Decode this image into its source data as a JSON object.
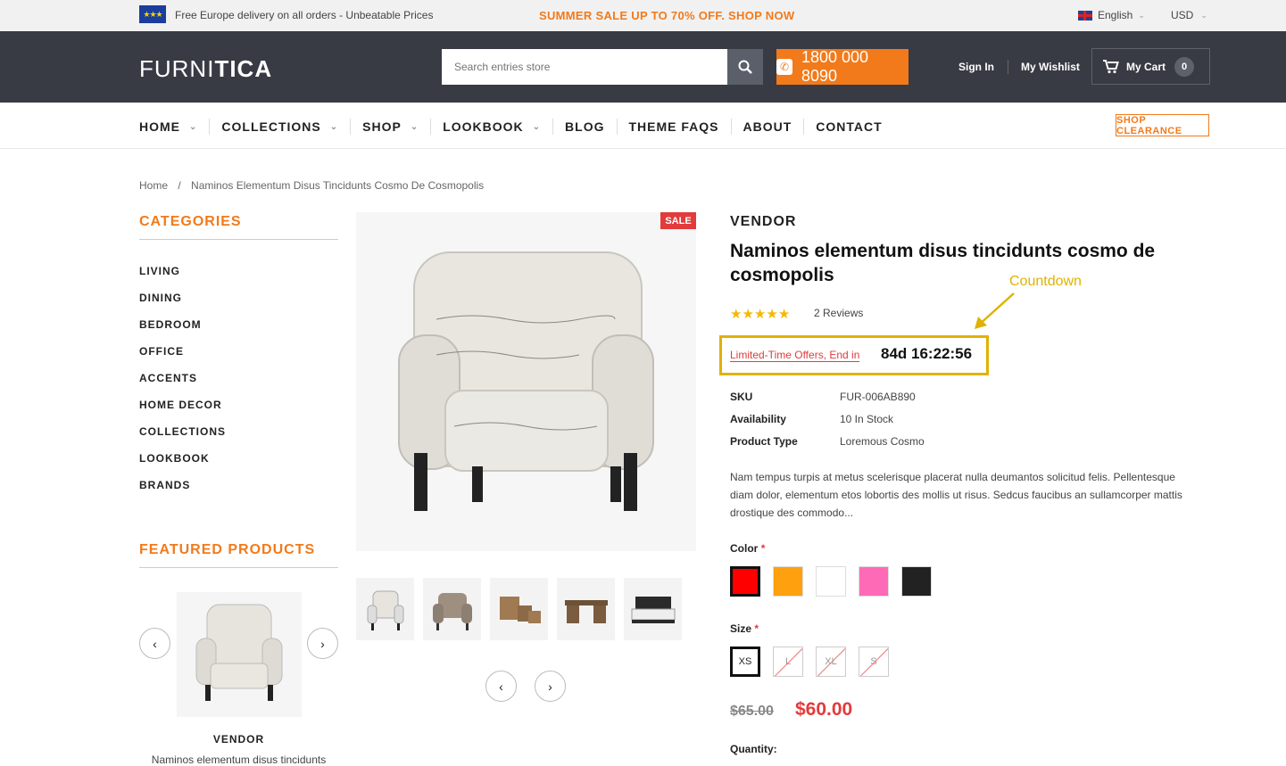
{
  "topbar": {
    "flag_icon": "eu-flag-icon",
    "delivery_text": "Free Europe delivery on all orders - Unbeatable Prices",
    "sale_text": "SUMMER SALE UP TO 70% OFF. SHOP NOW",
    "language": "English",
    "currency": "USD"
  },
  "header": {
    "logo_light": "FURNI",
    "logo_bold": "TICA",
    "search_placeholder": "Search entries store",
    "phone": "1800 000 8090",
    "signin": "Sign In",
    "wishlist": "My Wishlist",
    "cart_label": "My Cart",
    "cart_count": "0"
  },
  "nav": {
    "items": [
      {
        "label": "HOME",
        "dropdown": true
      },
      {
        "label": "COLLECTIONS",
        "dropdown": true
      },
      {
        "label": "SHOP",
        "dropdown": true
      },
      {
        "label": "LOOKBOOK",
        "dropdown": true
      },
      {
        "label": "BLOG",
        "dropdown": false
      },
      {
        "label": "THEME FAQS",
        "dropdown": false
      },
      {
        "label": "ABOUT",
        "dropdown": false
      },
      {
        "label": "CONTACT",
        "dropdown": false
      }
    ],
    "clearance": "SHOP CLEARANCE"
  },
  "breadcrumb": {
    "home": "Home",
    "separator": "/",
    "current": "Naminos Elementum Disus Tincidunts Cosmo De Cosmopolis"
  },
  "sidebar": {
    "categories_title": "CATEGORIES",
    "categories": [
      "LIVING",
      "DINING",
      "BEDROOM",
      "OFFICE",
      "ACCENTS",
      "HOME DECOR",
      "COLLECTIONS",
      "LOOKBOOK",
      "BRANDS"
    ],
    "featured_title": "FEATURED PRODUCTS",
    "featured_vendor": "VENDOR",
    "featured_name": "Naminos elementum disus tincidunts"
  },
  "gallery": {
    "sale_tag": "SALE",
    "thumbnails": [
      "armchair-thumb",
      "sofa-chair-thumb",
      "baskets-thumb",
      "desk-thumb",
      "bed-thumb"
    ]
  },
  "product": {
    "vendor": "VENDOR",
    "title": "Naminos elementum disus tincidunts cosmo de cosmopolis",
    "rating": 5,
    "reviews": "2 Reviews",
    "annotation": "Countdown",
    "offer_text": "Limited-Time Offers, End in",
    "timer": "84d 16:22:56",
    "meta": [
      {
        "key": "SKU",
        "value": "FUR-006AB890"
      },
      {
        "key": "Availability",
        "value": "10 In Stock"
      },
      {
        "key": "Product Type",
        "value": "Loremous Cosmo"
      }
    ],
    "description": "Nam tempus turpis at metus scelerisque placerat nulla deumantos solicitud felis. Pellentesque diam dolor, elementum etos lobortis des mollis ut risus. Sedcus faucibus an sullamcorper mattis drostique des commodo...",
    "color_label": "Color",
    "colors": [
      "#ff0000",
      "#ffa00e",
      "#ffffff",
      "#ff6ab7",
      "#222222"
    ],
    "size_label": "Size",
    "sizes": [
      {
        "label": "XS",
        "available": true
      },
      {
        "label": "L",
        "available": false
      },
      {
        "label": "XL",
        "available": false
      },
      {
        "label": "S",
        "available": false
      }
    ],
    "old_price": "$65.00",
    "new_price": "$60.00",
    "quantity_label": "Quantity:"
  },
  "colors": {
    "accent": "#f27a1a",
    "header_bg": "#383b44",
    "sale_red": "#e23b3b",
    "annotation_yellow": "#e0b200"
  }
}
